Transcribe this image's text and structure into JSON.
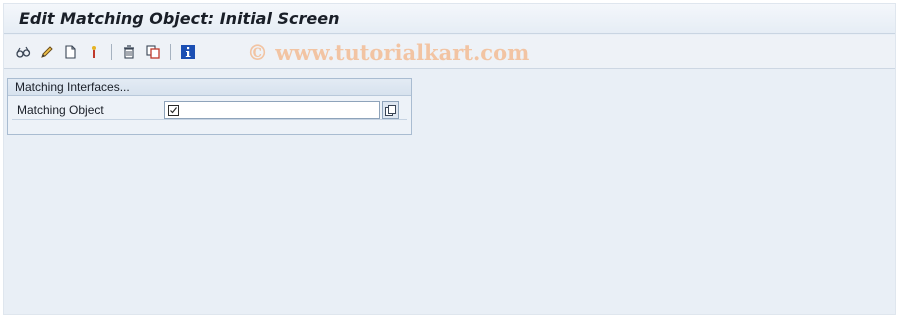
{
  "window": {
    "title": "Edit Matching Object: Initial Screen"
  },
  "toolbar": {
    "buttons": [
      {
        "name": "display-icon"
      },
      {
        "name": "change-pencil-icon"
      },
      {
        "name": "create-document-icon"
      },
      {
        "name": "other-object-icon"
      },
      {
        "name": "delete-trash-icon"
      },
      {
        "name": "copy-icon"
      },
      {
        "name": "info-icon"
      }
    ]
  },
  "watermark": {
    "text": "© www.tutorialkart.com"
  },
  "group": {
    "title": "Matching Interfaces...",
    "fields": [
      {
        "label": "Matching Object",
        "value": ""
      }
    ]
  },
  "colors": {
    "background": "#e9eff6",
    "watermark": "#f2c4a3",
    "info_icon": "#1b4fb3"
  }
}
